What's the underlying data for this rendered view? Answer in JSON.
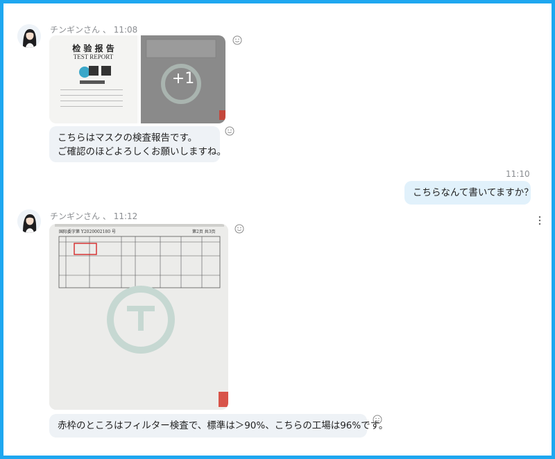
{
  "messages": [
    {
      "sender": "チンギンさん",
      "time": "11:08",
      "doc_title": "检 验 报 告",
      "doc_subtitle": "TEST REPORT",
      "extra_count": "+1",
      "text_lines": [
        "こちらはマスクの検査報告です。",
        "ご確認のほどよろしくお願いしますね。"
      ]
    },
    {
      "time": "11:10",
      "text": "こちらなんて書いてますか？"
    },
    {
      "sender": "チンギンさん",
      "time": "11:12",
      "report_number": "国际委字第 Y2020002180 号",
      "page_info": "第2页 共3页",
      "text": "赤枠のところはフィルター検査で、標準は＞90%、こちらの工場は96%です。"
    }
  ],
  "separator": "、",
  "colors": {
    "accent": "#1ea7f0",
    "bubble_other": "#eef2f6",
    "bubble_me": "#e1f1fb"
  }
}
